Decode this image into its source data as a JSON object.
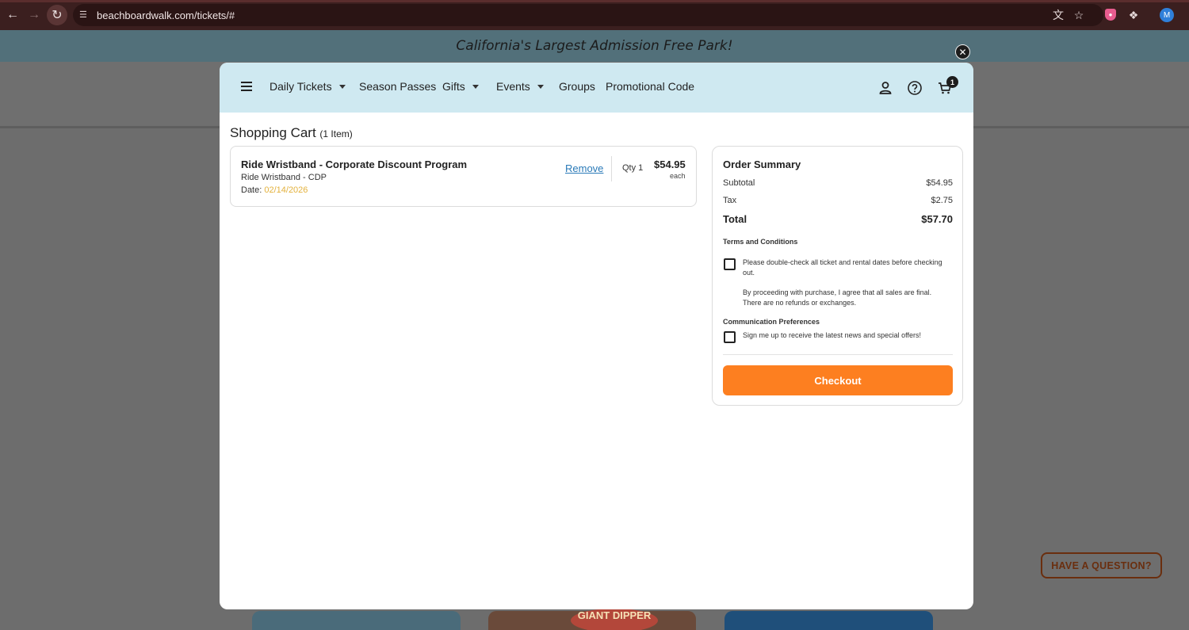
{
  "browser": {
    "url": "beachboardwalk.com/tickets/#",
    "profile_initial": "M"
  },
  "page": {
    "banner": "California's Largest Admission Free Park!",
    "have_question": "HAVE A QUESTION?",
    "thumb_text": "GIANT DIPPER"
  },
  "nav": {
    "items": [
      {
        "label": "Daily Tickets"
      },
      {
        "label": "Season Passes"
      },
      {
        "label": "Gifts"
      },
      {
        "label": "Events"
      },
      {
        "label": "Groups"
      },
      {
        "label": "Promotional Code"
      }
    ],
    "cart_count": "1"
  },
  "cart": {
    "title": "Shopping Cart",
    "count_text": "(1 Item)",
    "item": {
      "name": "Ride Wristband - Corporate Discount Program",
      "subtitle": "Ride Wristband - CDP",
      "date_label": "Date: ",
      "date_value": "02/14/2026",
      "remove": "Remove",
      "qty": "Qty 1",
      "price": "$54.95",
      "each": "each"
    }
  },
  "summary": {
    "title": "Order Summary",
    "subtotal_label": "Subtotal",
    "subtotal_value": "$54.95",
    "tax_label": "Tax",
    "tax_value": "$2.75",
    "total_label": "Total",
    "total_value": "$57.70",
    "terms_heading": "Terms and Conditions",
    "terms_text_1": "Please double-check all ticket and rental dates before checking out.",
    "terms_text_2": "By proceeding with purchase, I agree that all sales are final. There are no refunds or exchanges.",
    "comm_heading": "Communication Preferences",
    "comm_text": "Sign me up to receive the latest news and special offers!",
    "checkout": "Checkout"
  },
  "colors": {
    "nav_bg": "#cfe9f1",
    "checkout": "#fd7f20",
    "date": "#e3b13c",
    "link": "#2a7ab8"
  }
}
